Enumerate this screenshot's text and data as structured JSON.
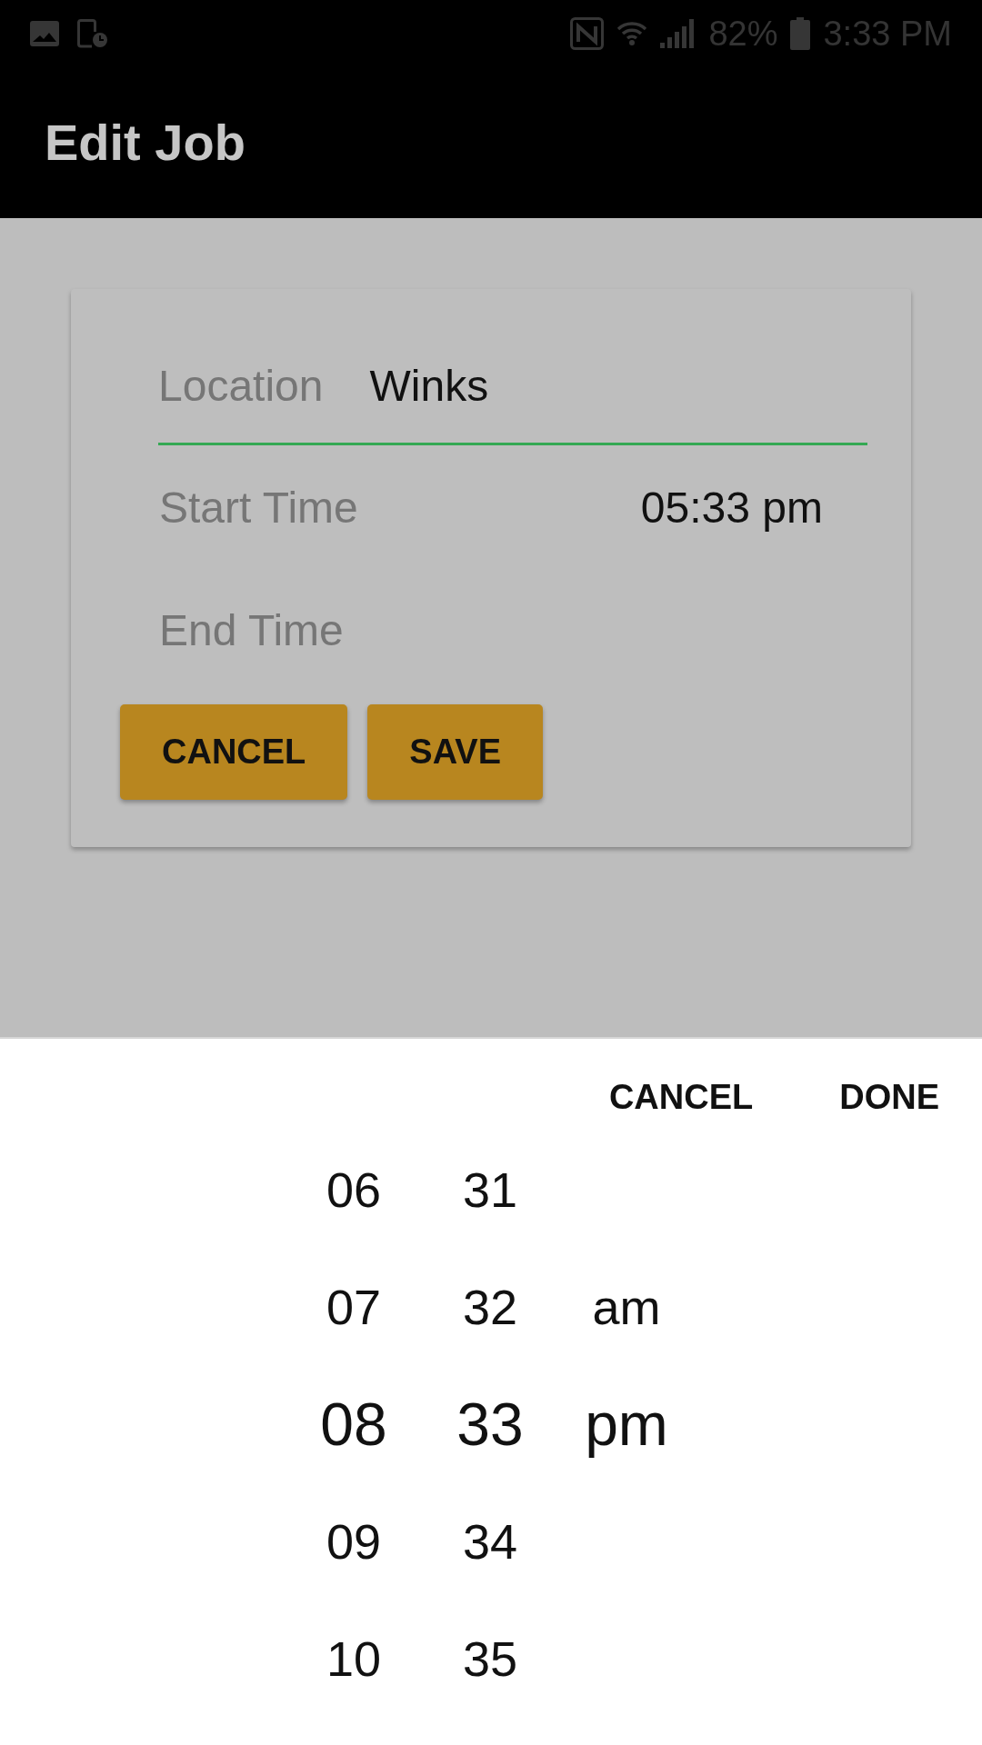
{
  "status_bar": {
    "battery": "82%",
    "time": "3:33 PM"
  },
  "app_bar": {
    "title": "Edit Job"
  },
  "form": {
    "fields": [
      {
        "kind": "text",
        "label": "Location",
        "value": "Winks",
        "focused": true
      },
      {
        "kind": "time",
        "label": "Start Time",
        "value": "05:33 pm",
        "focused": false
      },
      {
        "kind": "time",
        "label": "End Time",
        "focused": false
      }
    ],
    "buttons": [
      "CANCEL",
      "SAVE"
    ]
  },
  "time_picker": {
    "actions": [
      "CANCEL",
      "DONE"
    ],
    "columns": [
      {
        "items": [
          {
            "label": "06",
            "selected": false
          },
          {
            "label": "07",
            "selected": false
          },
          {
            "label": "08",
            "selected": true
          },
          {
            "label": "09",
            "selected": false
          },
          {
            "label": "10",
            "selected": false
          }
        ]
      },
      {
        "items": [
          {
            "label": "31",
            "selected": false
          },
          {
            "label": "32",
            "selected": false
          },
          {
            "label": "33",
            "selected": true
          },
          {
            "label": "34",
            "selected": false
          },
          {
            "label": "35",
            "selected": false
          }
        ]
      },
      {
        "items": [
          {
            "label": "am",
            "selected": false
          },
          {
            "label": "pm",
            "selected": true
          }
        ]
      }
    ]
  }
}
